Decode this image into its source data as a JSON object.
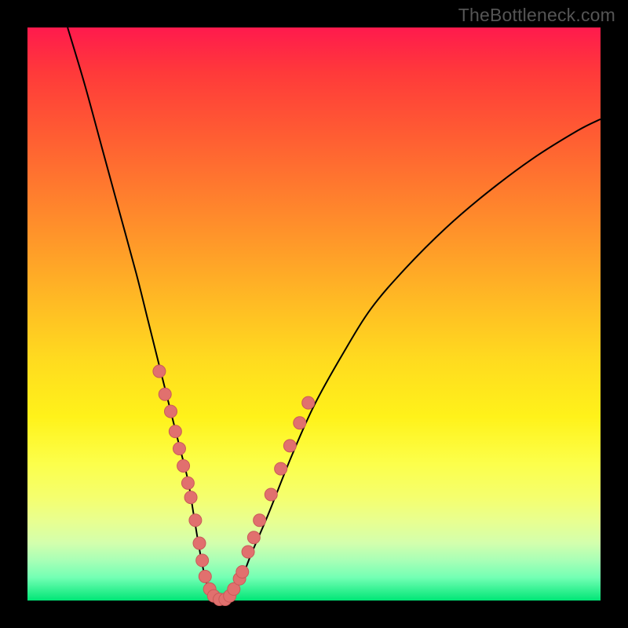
{
  "watermark": "TheBottleneck.com",
  "chart_data": {
    "type": "line",
    "title": "",
    "xlabel": "",
    "ylabel": "",
    "xlim": [
      0,
      100
    ],
    "ylim": [
      0,
      100
    ],
    "grid": false,
    "series": [
      {
        "name": "bottleneck-curve",
        "x": [
          7,
          10,
          13,
          16,
          19,
          21,
          23,
          25,
          26.5,
          28,
          29,
          30,
          31,
          32,
          33.5,
          35,
          37,
          39,
          42,
          46,
          50,
          55,
          60,
          66,
          73,
          80,
          88,
          96,
          100
        ],
        "values": [
          100,
          90,
          79,
          68,
          57,
          49,
          41,
          33,
          27,
          21,
          15,
          9,
          4,
          1,
          0,
          0.5,
          3,
          8,
          15,
          25,
          34,
          43,
          51,
          58,
          65,
          71,
          77,
          82,
          84
        ]
      }
    ],
    "dots": {
      "name": "highlight-dots",
      "coords": [
        [
          23.0,
          40.0
        ],
        [
          24.0,
          36.0
        ],
        [
          25.0,
          33.0
        ],
        [
          25.8,
          29.5
        ],
        [
          26.5,
          26.5
        ],
        [
          27.2,
          23.5
        ],
        [
          28.0,
          20.5
        ],
        [
          28.5,
          18.0
        ],
        [
          29.3,
          14.0
        ],
        [
          30.0,
          10.0
        ],
        [
          30.5,
          7.0
        ],
        [
          31.0,
          4.2
        ],
        [
          31.8,
          2.0
        ],
        [
          32.5,
          0.8
        ],
        [
          33.5,
          0.2
        ],
        [
          34.5,
          0.2
        ],
        [
          35.3,
          0.8
        ],
        [
          36.0,
          2.0
        ],
        [
          37.0,
          3.8
        ],
        [
          37.5,
          5.0
        ],
        [
          38.5,
          8.5
        ],
        [
          39.5,
          11.0
        ],
        [
          40.5,
          14.0
        ],
        [
          42.5,
          18.5
        ],
        [
          44.2,
          23.0
        ],
        [
          45.8,
          27.0
        ],
        [
          47.5,
          31.0
        ],
        [
          49.0,
          34.5
        ]
      ]
    },
    "colors": {
      "curve": "#000000",
      "dot_fill": "#e1706e",
      "dot_stroke": "#c95a58"
    }
  }
}
